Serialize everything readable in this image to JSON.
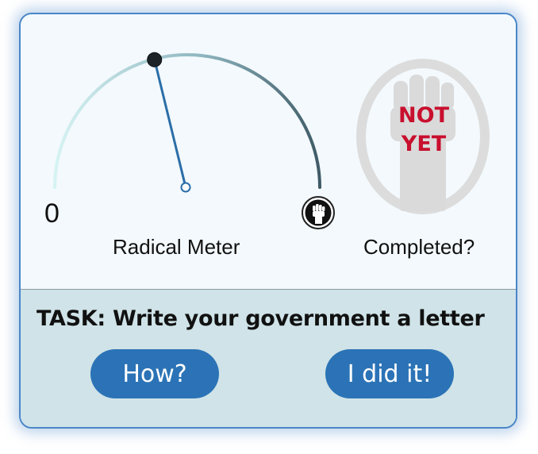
{
  "meter": {
    "min_label": "0",
    "label": "Radical Meter",
    "level": 0.42,
    "gradient_start": "#d6f3f3",
    "gradient_end": "#3f5a66",
    "needle_color": "#2b6ea8",
    "end_icon": "raised-fist-icon"
  },
  "completion": {
    "label": "Completed?",
    "status_line1": "NOT",
    "status_line2": "YET",
    "status_color": "#c8102e",
    "stamp_icon": "raised-fist-icon"
  },
  "task": {
    "text": "TASK: Write your government a letter"
  },
  "buttons": {
    "how_label": "How?",
    "done_label": "I did it!",
    "color": "#2b73b6"
  }
}
